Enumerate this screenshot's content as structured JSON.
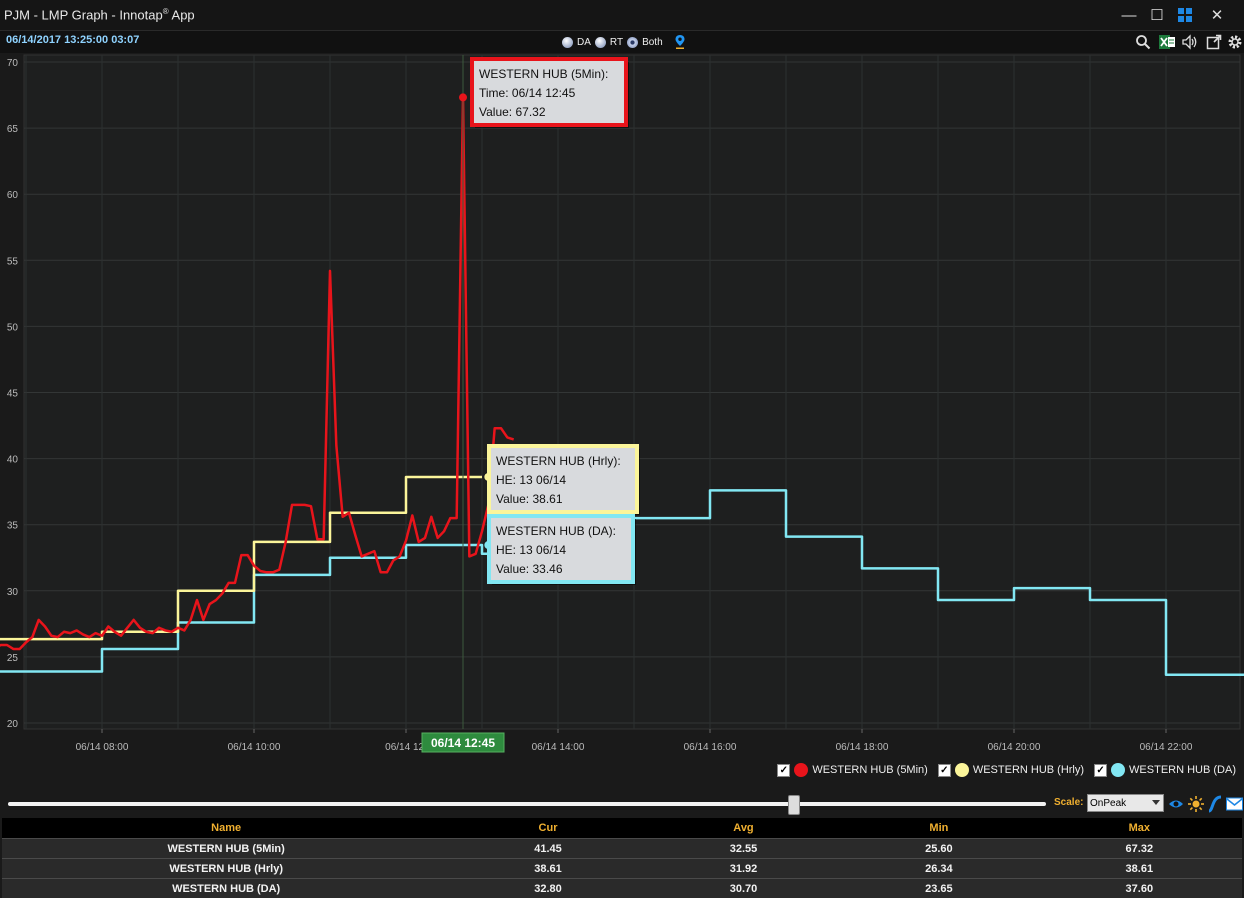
{
  "window": {
    "title_prefix": "PJM - LMP Graph - Innotap",
    "title_reg": "®",
    "title_suffix": " App",
    "minimize_label": "—",
    "maximize_label": "☐",
    "close_label": "✕"
  },
  "toolbar": {
    "datetime": "06/14/2017 13:25:00  03:07",
    "modes": [
      {
        "label": "DA",
        "selected": false
      },
      {
        "label": "RT",
        "selected": false
      },
      {
        "label": "Both",
        "selected": true
      }
    ],
    "icons": [
      "pin-icon",
      "search-icon",
      "excel-icon",
      "speaker-icon",
      "popout-icon",
      "gear-icon"
    ]
  },
  "chart_data": {
    "type": "line",
    "x_range": [
      "06/14 06:35",
      "06/14 23:55"
    ],
    "ylim": [
      20,
      70
    ],
    "y_ticks": [
      "20",
      "25",
      "30",
      "35",
      "40",
      "45",
      "50",
      "55",
      "60",
      "65",
      "70"
    ],
    "x_ticks": [
      "06/14 08:00",
      "06/14 10:00",
      "06/14 12:00",
      "06/14 14:00",
      "06/14 16:00",
      "06/14 18:00",
      "06/14 20:00",
      "06/14 22:00"
    ],
    "x_ticks_shown": [
      "06/14 08:00",
      "06/14 10:00",
      "06/14 12:",
      "06/14 14:00",
      "06/14 16:00",
      "06/14 18:00",
      "06/14 20:00",
      "06/14 22:00"
    ],
    "grid": true,
    "legend_position": "bottom-right",
    "crosshair": {
      "time": "06/14 12:45",
      "label": "06/14 12:45"
    },
    "series": [
      {
        "name": "WESTERN HUB (5Min)",
        "color": "#e8141b",
        "step": false,
        "points": [
          [
            "06:35",
            25.6
          ],
          [
            "06:40",
            25.9
          ],
          [
            "06:45",
            25.9
          ],
          [
            "06:50",
            25.6
          ],
          [
            "06:55",
            25.6
          ],
          [
            "07:00",
            26.1
          ],
          [
            "07:05",
            26.5
          ],
          [
            "07:10",
            27.8
          ],
          [
            "07:15",
            27.3
          ],
          [
            "07:20",
            26.6
          ],
          [
            "07:25",
            26.5
          ],
          [
            "07:30",
            26.9
          ],
          [
            "07:35",
            26.8
          ],
          [
            "07:40",
            27.0
          ],
          [
            "07:45",
            26.7
          ],
          [
            "07:50",
            26.5
          ],
          [
            "07:55",
            26.8
          ],
          [
            "08:00",
            26.6
          ],
          [
            "08:05",
            27.3
          ],
          [
            "08:10",
            26.9
          ],
          [
            "08:15",
            26.6
          ],
          [
            "08:20",
            27.2
          ],
          [
            "08:25",
            27.8
          ],
          [
            "08:30",
            27.2
          ],
          [
            "08:35",
            26.9
          ],
          [
            "08:40",
            26.8
          ],
          [
            "08:45",
            27.2
          ],
          [
            "08:50",
            27.0
          ],
          [
            "08:55",
            26.9
          ],
          [
            "09:00",
            27.2
          ],
          [
            "09:05",
            27.0
          ],
          [
            "09:10",
            27.8
          ],
          [
            "09:15",
            29.3
          ],
          [
            "09:20",
            27.8
          ],
          [
            "09:25",
            29.0
          ],
          [
            "09:30",
            29.3
          ],
          [
            "09:35",
            29.8
          ],
          [
            "09:40",
            30.6
          ],
          [
            "09:45",
            30.6
          ],
          [
            "09:50",
            32.7
          ],
          [
            "09:55",
            32.7
          ],
          [
            "10:00",
            31.9
          ],
          [
            "10:05",
            31.5
          ],
          [
            "10:10",
            31.4
          ],
          [
            "10:15",
            31.4
          ],
          [
            "10:20",
            31.6
          ],
          [
            "10:25",
            33.7
          ],
          [
            "10:30",
            36.5
          ],
          [
            "10:35",
            36.5
          ],
          [
            "10:40",
            36.5
          ],
          [
            "10:45",
            36.4
          ],
          [
            "10:50",
            33.9
          ],
          [
            "10:55",
            33.9
          ],
          [
            "11:00",
            54.2
          ],
          [
            "11:05",
            41.0
          ],
          [
            "11:10",
            35.6
          ],
          [
            "11:15",
            35.9
          ],
          [
            "11:20",
            34.2
          ],
          [
            "11:25",
            32.6
          ],
          [
            "11:30",
            32.8
          ],
          [
            "11:35",
            33.0
          ],
          [
            "11:40",
            31.4
          ],
          [
            "11:45",
            31.4
          ],
          [
            "11:50",
            32.3
          ],
          [
            "11:55",
            32.6
          ],
          [
            "12:00",
            33.8
          ],
          [
            "12:05",
            35.7
          ],
          [
            "12:10",
            33.7
          ],
          [
            "12:15",
            34.0
          ],
          [
            "12:20",
            35.6
          ],
          [
            "12:25",
            34.0
          ],
          [
            "12:30",
            34.5
          ],
          [
            "12:35",
            35.5
          ],
          [
            "12:40",
            35.5
          ],
          [
            "12:45",
            67.32
          ],
          [
            "12:50",
            32.6
          ],
          [
            "12:55",
            32.8
          ],
          [
            "13:00",
            34.5
          ],
          [
            "13:05",
            36.5
          ],
          [
            "13:10",
            42.3
          ],
          [
            "13:15",
            42.3
          ],
          [
            "13:20",
            41.6
          ],
          [
            "13:25",
            41.45
          ]
        ],
        "tooltip": {
          "title": "WESTERN HUB (5Min):",
          "line2": "Time: 06/14 12:45",
          "line3": "Value: 67.32"
        }
      },
      {
        "name": "WESTERN HUB (Hrly)",
        "color": "#fbf59a",
        "step": true,
        "points": [
          [
            "06:35",
            26.34
          ],
          [
            "07:00",
            26.34
          ],
          [
            "08:00",
            26.9
          ],
          [
            "09:00",
            30.0
          ],
          [
            "10:00",
            33.7
          ],
          [
            "11:00",
            35.9
          ],
          [
            "12:00",
            38.61
          ],
          [
            "13:00",
            38.61
          ]
        ],
        "tooltip": {
          "title": "WESTERN HUB (Hrly):",
          "line2": "HE: 13  06/14",
          "line3": "Value: 38.61"
        }
      },
      {
        "name": "WESTERN HUB (DA)",
        "color": "#82e7f3",
        "step": true,
        "points": [
          [
            "06:35",
            23.9
          ],
          [
            "07:00",
            23.9
          ],
          [
            "08:00",
            25.6
          ],
          [
            "09:00",
            27.6
          ],
          [
            "10:00",
            31.2
          ],
          [
            "11:00",
            32.5
          ],
          [
            "12:00",
            33.46
          ],
          [
            "13:00",
            32.8
          ],
          [
            "14:00",
            35.5
          ],
          [
            "15:00",
            35.5
          ],
          [
            "16:00",
            37.6
          ],
          [
            "17:00",
            34.1
          ],
          [
            "18:00",
            31.7
          ],
          [
            "19:00",
            29.3
          ],
          [
            "20:00",
            30.2
          ],
          [
            "21:00",
            29.3
          ],
          [
            "22:00",
            23.65
          ],
          [
            "23:55",
            23.65
          ]
        ],
        "tooltip": {
          "title": "WESTERN HUB (DA):",
          "line2": "HE: 13  06/14",
          "line3": "Value: 33.46"
        }
      }
    ]
  },
  "legend": {
    "items": [
      {
        "label": "WESTERN HUB (5Min)",
        "color": "#e8141b",
        "checked": true
      },
      {
        "label": "WESTERN HUB (Hrly)",
        "color": "#fbf59a",
        "checked": true
      },
      {
        "label": "WESTERN HUB (DA)",
        "color": "#82e7f3",
        "checked": true
      }
    ]
  },
  "slider": {
    "value_pct": 75.6
  },
  "scale": {
    "label": "Scale:",
    "value": "OnPeak"
  },
  "stats": {
    "columns": [
      "Name",
      "Cur",
      "Avg",
      "Min",
      "Max"
    ],
    "rows": [
      [
        "WESTERN HUB (5Min)",
        "41.45",
        "32.55",
        "25.60",
        "67.32"
      ],
      [
        "WESTERN HUB (Hrly)",
        "38.61",
        "31.92",
        "26.34",
        "38.61"
      ],
      [
        "WESTERN HUB (DA)",
        "32.80",
        "30.70",
        "23.65",
        "37.60"
      ]
    ]
  },
  "colors": {
    "accent": "#f0b030",
    "highlight_green": "#2e8b3e"
  }
}
